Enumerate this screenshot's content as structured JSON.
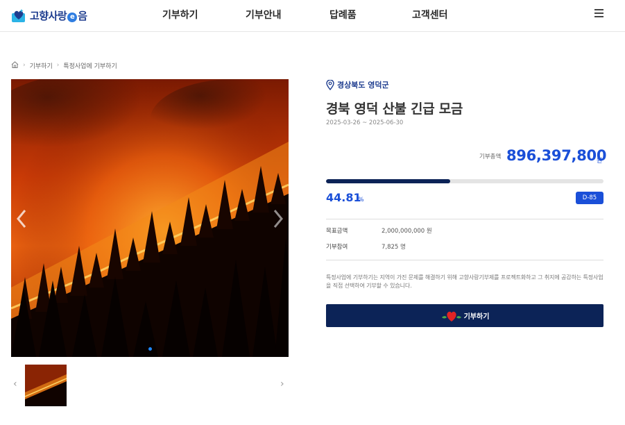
{
  "header": {
    "logo_text_a": "고향사랑",
    "logo_e": "e",
    "logo_text_b": "음",
    "nav": [
      "기부하기",
      "기부안내",
      "답례품",
      "고객센터"
    ],
    "menu_icon": "hamburger-icon"
  },
  "breadcrumb": {
    "home_icon": "home-icon",
    "items": [
      "기부하기",
      "특정사업에 기부하기"
    ]
  },
  "gallery": {
    "prev_icon": "chevron-left-icon",
    "next_icon": "chevron-right-icon",
    "dots": 1
  },
  "project": {
    "location": "경상북도 영덕군",
    "title": "경북 영덕 산불 긴급 모금",
    "period": "2025-03-26 ~ 2025-06-30",
    "total_label": "기부총액",
    "total_amount": "896,397,800",
    "total_unit": "원",
    "progress": 0.4481,
    "percent": "44.81",
    "percent_unit": "%",
    "dday": "D-85",
    "goal_label": "목표금액",
    "goal_value": "2,000,000,000 원",
    "participants_label": "기부참여",
    "participants_value": "7,825 명",
    "description": "특정사업에 기부하기는 지역이 가진 문제를 해결하기 위해 고향사랑기부제를 프로젝트화하고 그 취지에 공감하는 특정사업을 직접 선택하여 기부할 수 있습니다.",
    "donate_label": "기부하기"
  },
  "colors": {
    "brand_navy": "#0c2357",
    "accent_blue": "#1a4fd8",
    "logo_blue": "#1e3d8f"
  }
}
